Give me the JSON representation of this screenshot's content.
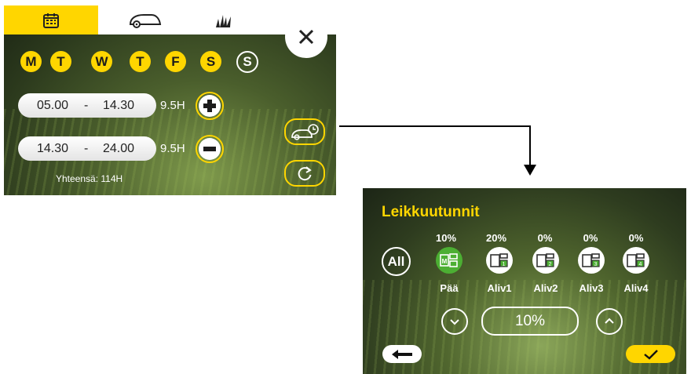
{
  "schedule": {
    "tabs": [
      {
        "icon": "calendar-icon",
        "active": true
      },
      {
        "icon": "mower-icon",
        "active": false
      },
      {
        "icon": "grass-icon",
        "active": false
      }
    ],
    "days": [
      {
        "label": "M",
        "selected": true
      },
      {
        "label": "T",
        "selected": true
      },
      {
        "label": "W",
        "selected": true
      },
      {
        "label": "T",
        "selected": true
      },
      {
        "label": "F",
        "selected": true
      },
      {
        "label": "S",
        "selected": true
      },
      {
        "label": "S",
        "selected": false
      }
    ],
    "slots": [
      {
        "start": "05.00",
        "sep": "-",
        "end": "14.30",
        "hours": "9.5H",
        "action": "add"
      },
      {
        "start": "14.30",
        "sep": "-",
        "end": "24.00",
        "hours": "9.5H",
        "action": "remove"
      }
    ],
    "total": "Yhteensä: 114H",
    "accent": "#ffd600"
  },
  "zones": {
    "title": "Leikkuutunnit",
    "all_label": "All",
    "items": [
      {
        "percent": "10%",
        "label": "Pää",
        "icon": "main-zone-icon",
        "badge": "M",
        "selected": true
      },
      {
        "percent": "20%",
        "label": "Aliv1",
        "icon": "subzone-icon",
        "badge": "1",
        "selected": false
      },
      {
        "percent": "0%",
        "label": "Aliv2",
        "icon": "subzone-icon",
        "badge": "2",
        "selected": false
      },
      {
        "percent": "0%",
        "label": "Aliv3",
        "icon": "subzone-icon",
        "badge": "3",
        "selected": false
      },
      {
        "percent": "0%",
        "label": "Aliv4",
        "icon": "subzone-icon",
        "badge": "4",
        "selected": false
      }
    ],
    "value": "10%",
    "accent": "#ffd600",
    "selected_color": "#4caf33"
  }
}
